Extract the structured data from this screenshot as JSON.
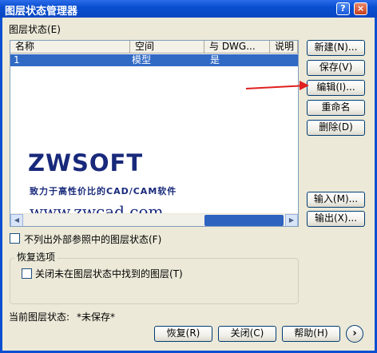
{
  "window": {
    "title": "图层状态管理器",
    "help_btn": "?",
    "close_btn": "×"
  },
  "section_label": "图层状态(E)",
  "columns": [
    "名称",
    "空间",
    "与 DWG...",
    "说明"
  ],
  "rows": [
    {
      "name": "1",
      "space": "模型",
      "same_as_dwg": "是",
      "description": ""
    }
  ],
  "watermark": {
    "brand": "ZWSOFT",
    "tagline": "致力于高性价比的CAD/CAM软件",
    "url": "www.zwcad.com"
  },
  "right_buttons": {
    "new": "新建(N)...",
    "save": "保存(V)",
    "edit": "编辑(I)...",
    "rename": "重命名",
    "delete": "删除(D)",
    "import": "输入(M)...",
    "export": "输出(X)..."
  },
  "exclude_xref_label": "不列出外部参照中的图层状态(F)",
  "restore_group": {
    "title": "恢复选项",
    "close_layers_label": "关闭未在图层状态中找到的图层(T)"
  },
  "current_state": {
    "label": "当前图层状态:",
    "value": "*未保存*"
  },
  "bottom_buttons": {
    "restore": "恢复(R)",
    "close": "关闭(C)",
    "help": "帮助(H)",
    "more": "›"
  },
  "accent_colors": {
    "titlebar": "#0A4FD0",
    "selection": "#316AC5",
    "annotation_arrow": "#E02020"
  }
}
